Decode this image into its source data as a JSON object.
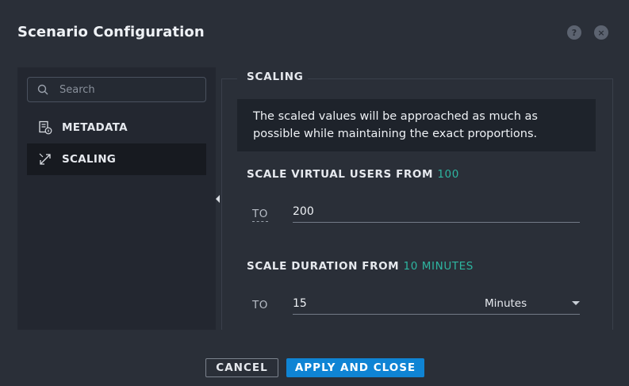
{
  "dialog": {
    "title": "Scenario Configuration",
    "help_icon": "?",
    "close_icon": "×"
  },
  "sidebar": {
    "search_placeholder": "Search",
    "items": [
      {
        "label": "METADATA",
        "icon": "document-info-icon"
      },
      {
        "label": "SCALING",
        "icon": "scaling-icon",
        "active": true
      }
    ]
  },
  "scaling": {
    "section_title": "SCALING",
    "info_text": "The scaled values will be approached as much as possible while maintaining the exact proportions.",
    "users_label": "SCALE VIRTUAL USERS FROM",
    "users_from": "100",
    "users_to_label": "TO",
    "users_to_value": "200",
    "duration_label": "SCALE DURATION FROM",
    "duration_from": "10 MINUTES",
    "duration_to_label": "TO",
    "duration_to_value": "15",
    "duration_unit": "Minutes"
  },
  "footer": {
    "cancel_label": "CANCEL",
    "apply_label": "APPLY AND CLOSE"
  },
  "colors": {
    "accent": "#2eb5a0",
    "primary_button": "#0f84d4",
    "background": "#2a2f38"
  }
}
